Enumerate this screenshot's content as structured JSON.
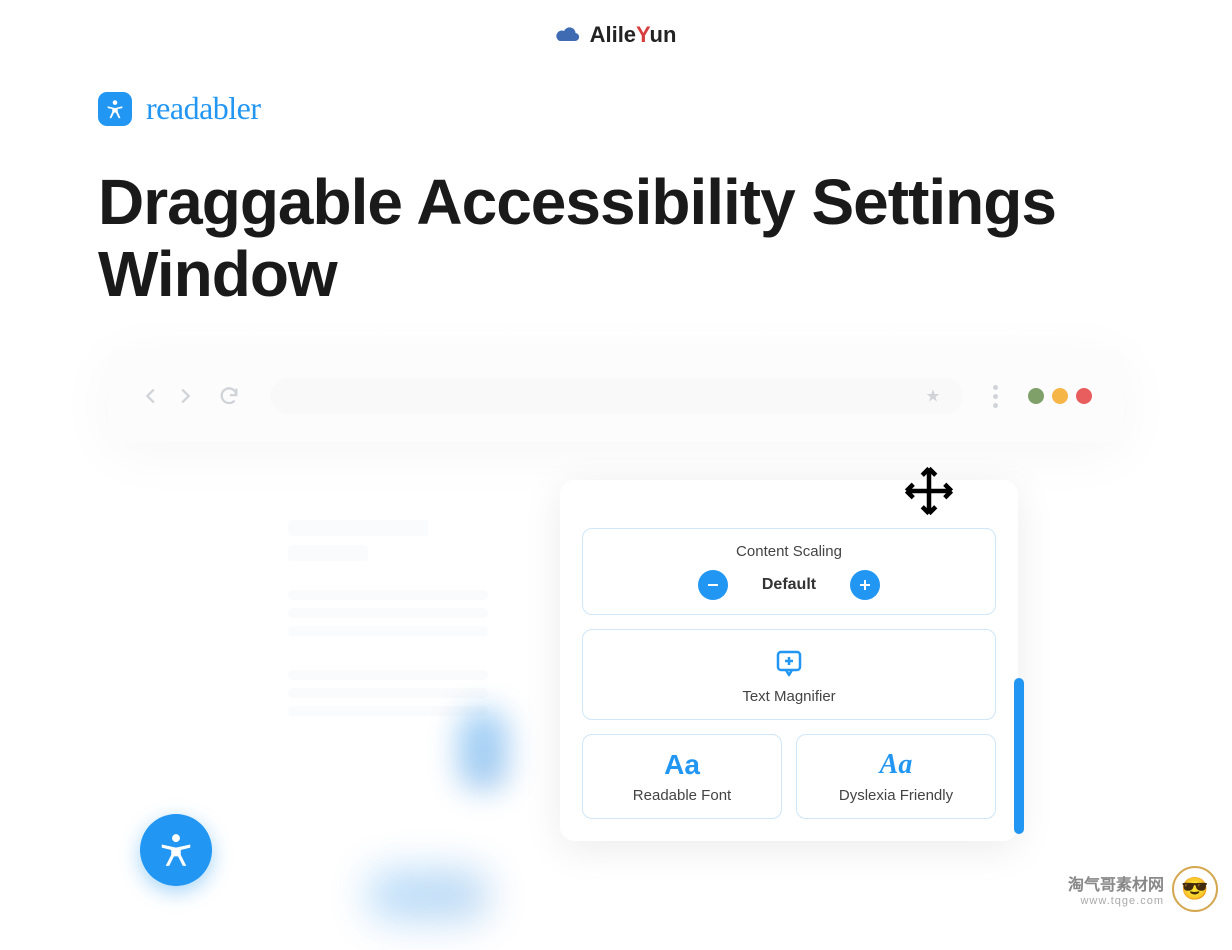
{
  "brand": {
    "name_pre": "Alile",
    "name_y": "Y",
    "name_post": "un"
  },
  "product": {
    "name": "readabler"
  },
  "heading": "Draggable Accessibility Settings Window",
  "settings": {
    "content_scaling": {
      "title": "Content Scaling",
      "value": "Default"
    },
    "text_magnifier": {
      "label": "Text Magnifier"
    },
    "readable_font": {
      "icon": "Aa",
      "label": "Readable Font"
    },
    "dyslexia_friendly": {
      "icon": "Aa",
      "label": "Dyslexia Friendly"
    }
  },
  "watermark": {
    "text": "淘气哥素材网",
    "url": "www.tqge.com"
  }
}
